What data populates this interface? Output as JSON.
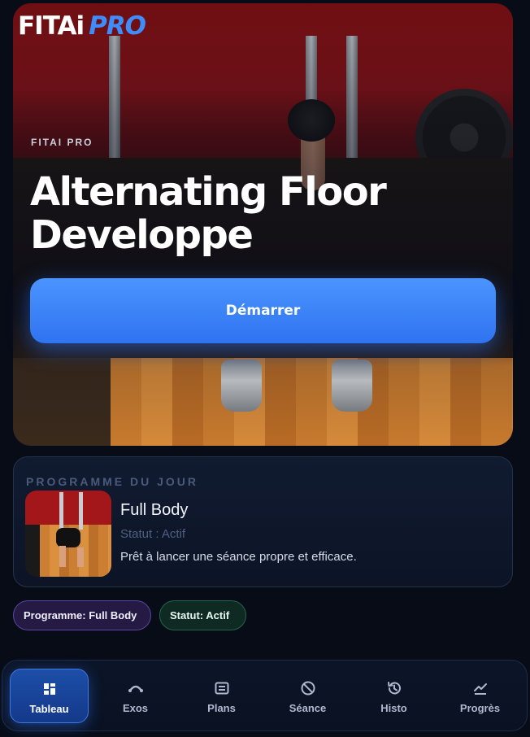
{
  "brand": {
    "part1": "FITAi",
    "part2": "PRO"
  },
  "hero": {
    "kicker": "FITAI PRO",
    "title": "Alternating Floor Developpe",
    "start_label": "Démarrer"
  },
  "program": {
    "heading": "PROGRAMME DU JOUR",
    "name": "Full Body",
    "status": "Statut : Actif",
    "description": "Prêt à lancer une séance propre et efficace."
  },
  "chips": {
    "program": "Programme: Full Body",
    "status": "Statut: Actif"
  },
  "nav": {
    "items": [
      {
        "label": "Tableau",
        "icon": "dashboard-icon",
        "active": true
      },
      {
        "label": "Exos",
        "icon": "exercise-icon",
        "active": false
      },
      {
        "label": "Plans",
        "icon": "plans-icon",
        "active": false
      },
      {
        "label": "Séance",
        "icon": "session-icon",
        "active": false
      },
      {
        "label": "Histo",
        "icon": "history-icon",
        "active": false
      },
      {
        "label": "Progrès",
        "icon": "progress-icon",
        "active": false
      }
    ]
  },
  "colors": {
    "accent": "#3f8cff",
    "background": "#070c17",
    "chip_program_bg": "#241a44",
    "chip_status_bg": "#0e2a22"
  }
}
